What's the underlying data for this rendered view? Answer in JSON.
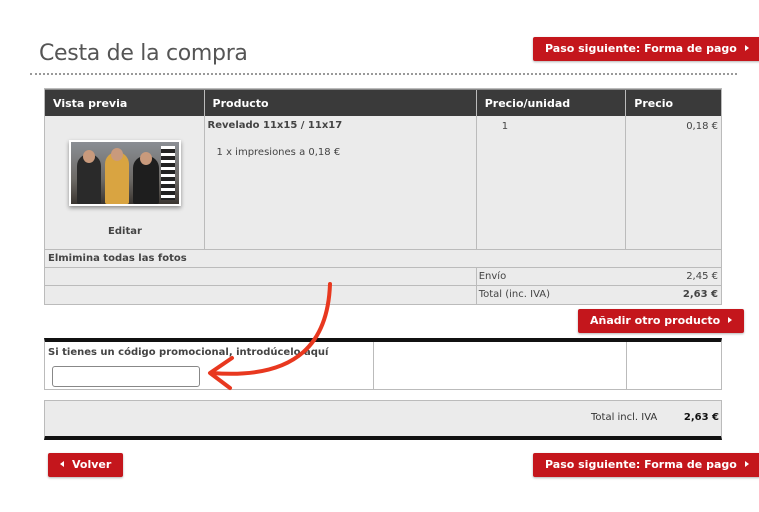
{
  "page": {
    "title": "Cesta de la compra"
  },
  "buttons": {
    "next_label": "Paso siguiente: Forma de pago",
    "add_label": "Añadir otro producto",
    "back_label": "Volver"
  },
  "cart": {
    "headers": [
      "Vista previa",
      "Producto",
      "Precio/unidad",
      "Precio"
    ],
    "item": {
      "edit_label": "Editar",
      "product_name": "Revelado 11x15 / 11x17",
      "product_detail": "1 x impresiones a 0,18 €",
      "quantity": "1",
      "price": "0,18 €"
    },
    "delete_all_label": "Elmimina todas las fotos",
    "shipping_label": "Envío",
    "shipping_value": "2,45 €",
    "total_label": "Total (inc. IVA)",
    "total_value": "2,63 €"
  },
  "promo": {
    "label": "Si tienes un código promocional, introdúcelo aquí",
    "value": ""
  },
  "summary": {
    "total_label": "Total incl. IVA",
    "total_value": "2,63 €"
  },
  "colors": {
    "accent": "#c4161c",
    "header_bg": "#3a3a3a",
    "annotation_arrow": "#e8381f"
  }
}
